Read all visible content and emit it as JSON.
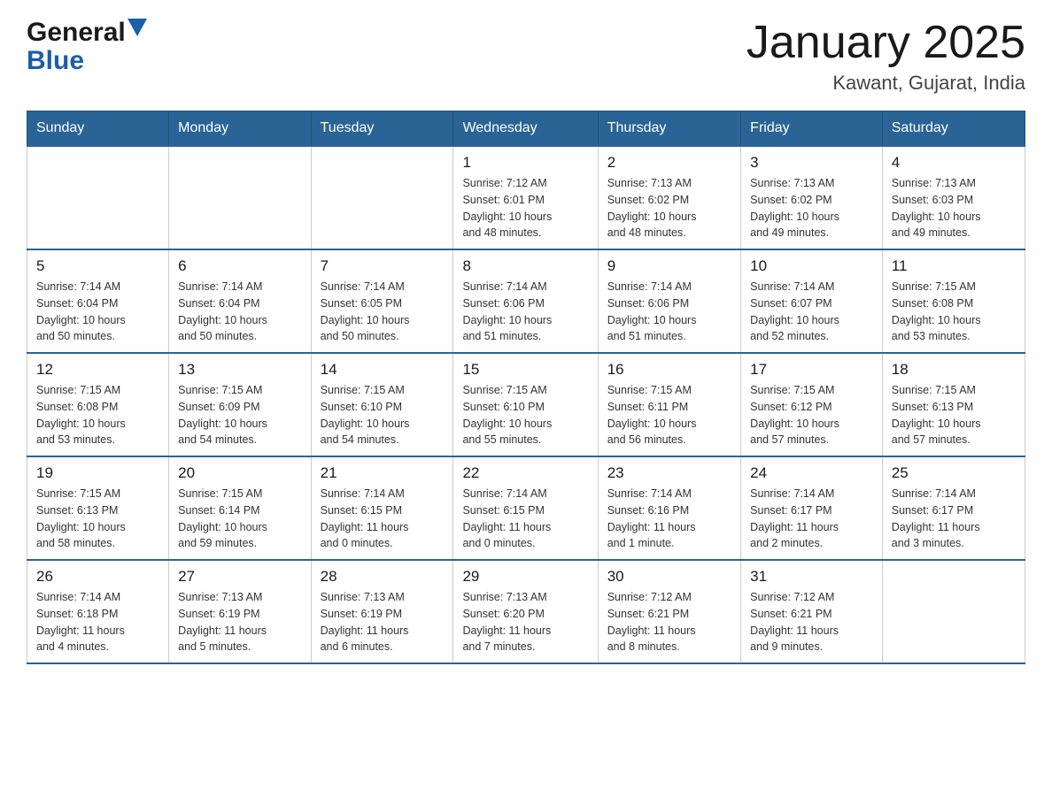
{
  "header": {
    "logo_line1": "General",
    "logo_line2": "Blue",
    "month_title": "January 2025",
    "location": "Kawant, Gujarat, India"
  },
  "weekdays": [
    "Sunday",
    "Monday",
    "Tuesday",
    "Wednesday",
    "Thursday",
    "Friday",
    "Saturday"
  ],
  "weeks": [
    [
      {
        "day": "",
        "info": ""
      },
      {
        "day": "",
        "info": ""
      },
      {
        "day": "",
        "info": ""
      },
      {
        "day": "1",
        "info": "Sunrise: 7:12 AM\nSunset: 6:01 PM\nDaylight: 10 hours\nand 48 minutes."
      },
      {
        "day": "2",
        "info": "Sunrise: 7:13 AM\nSunset: 6:02 PM\nDaylight: 10 hours\nand 48 minutes."
      },
      {
        "day": "3",
        "info": "Sunrise: 7:13 AM\nSunset: 6:02 PM\nDaylight: 10 hours\nand 49 minutes."
      },
      {
        "day": "4",
        "info": "Sunrise: 7:13 AM\nSunset: 6:03 PM\nDaylight: 10 hours\nand 49 minutes."
      }
    ],
    [
      {
        "day": "5",
        "info": "Sunrise: 7:14 AM\nSunset: 6:04 PM\nDaylight: 10 hours\nand 50 minutes."
      },
      {
        "day": "6",
        "info": "Sunrise: 7:14 AM\nSunset: 6:04 PM\nDaylight: 10 hours\nand 50 minutes."
      },
      {
        "day": "7",
        "info": "Sunrise: 7:14 AM\nSunset: 6:05 PM\nDaylight: 10 hours\nand 50 minutes."
      },
      {
        "day": "8",
        "info": "Sunrise: 7:14 AM\nSunset: 6:06 PM\nDaylight: 10 hours\nand 51 minutes."
      },
      {
        "day": "9",
        "info": "Sunrise: 7:14 AM\nSunset: 6:06 PM\nDaylight: 10 hours\nand 51 minutes."
      },
      {
        "day": "10",
        "info": "Sunrise: 7:14 AM\nSunset: 6:07 PM\nDaylight: 10 hours\nand 52 minutes."
      },
      {
        "day": "11",
        "info": "Sunrise: 7:15 AM\nSunset: 6:08 PM\nDaylight: 10 hours\nand 53 minutes."
      }
    ],
    [
      {
        "day": "12",
        "info": "Sunrise: 7:15 AM\nSunset: 6:08 PM\nDaylight: 10 hours\nand 53 minutes."
      },
      {
        "day": "13",
        "info": "Sunrise: 7:15 AM\nSunset: 6:09 PM\nDaylight: 10 hours\nand 54 minutes."
      },
      {
        "day": "14",
        "info": "Sunrise: 7:15 AM\nSunset: 6:10 PM\nDaylight: 10 hours\nand 54 minutes."
      },
      {
        "day": "15",
        "info": "Sunrise: 7:15 AM\nSunset: 6:10 PM\nDaylight: 10 hours\nand 55 minutes."
      },
      {
        "day": "16",
        "info": "Sunrise: 7:15 AM\nSunset: 6:11 PM\nDaylight: 10 hours\nand 56 minutes."
      },
      {
        "day": "17",
        "info": "Sunrise: 7:15 AM\nSunset: 6:12 PM\nDaylight: 10 hours\nand 57 minutes."
      },
      {
        "day": "18",
        "info": "Sunrise: 7:15 AM\nSunset: 6:13 PM\nDaylight: 10 hours\nand 57 minutes."
      }
    ],
    [
      {
        "day": "19",
        "info": "Sunrise: 7:15 AM\nSunset: 6:13 PM\nDaylight: 10 hours\nand 58 minutes."
      },
      {
        "day": "20",
        "info": "Sunrise: 7:15 AM\nSunset: 6:14 PM\nDaylight: 10 hours\nand 59 minutes."
      },
      {
        "day": "21",
        "info": "Sunrise: 7:14 AM\nSunset: 6:15 PM\nDaylight: 11 hours\nand 0 minutes."
      },
      {
        "day": "22",
        "info": "Sunrise: 7:14 AM\nSunset: 6:15 PM\nDaylight: 11 hours\nand 0 minutes."
      },
      {
        "day": "23",
        "info": "Sunrise: 7:14 AM\nSunset: 6:16 PM\nDaylight: 11 hours\nand 1 minute."
      },
      {
        "day": "24",
        "info": "Sunrise: 7:14 AM\nSunset: 6:17 PM\nDaylight: 11 hours\nand 2 minutes."
      },
      {
        "day": "25",
        "info": "Sunrise: 7:14 AM\nSunset: 6:17 PM\nDaylight: 11 hours\nand 3 minutes."
      }
    ],
    [
      {
        "day": "26",
        "info": "Sunrise: 7:14 AM\nSunset: 6:18 PM\nDaylight: 11 hours\nand 4 minutes."
      },
      {
        "day": "27",
        "info": "Sunrise: 7:13 AM\nSunset: 6:19 PM\nDaylight: 11 hours\nand 5 minutes."
      },
      {
        "day": "28",
        "info": "Sunrise: 7:13 AM\nSunset: 6:19 PM\nDaylight: 11 hours\nand 6 minutes."
      },
      {
        "day": "29",
        "info": "Sunrise: 7:13 AM\nSunset: 6:20 PM\nDaylight: 11 hours\nand 7 minutes."
      },
      {
        "day": "30",
        "info": "Sunrise: 7:12 AM\nSunset: 6:21 PM\nDaylight: 11 hours\nand 8 minutes."
      },
      {
        "day": "31",
        "info": "Sunrise: 7:12 AM\nSunset: 6:21 PM\nDaylight: 11 hours\nand 9 minutes."
      },
      {
        "day": "",
        "info": ""
      }
    ]
  ]
}
